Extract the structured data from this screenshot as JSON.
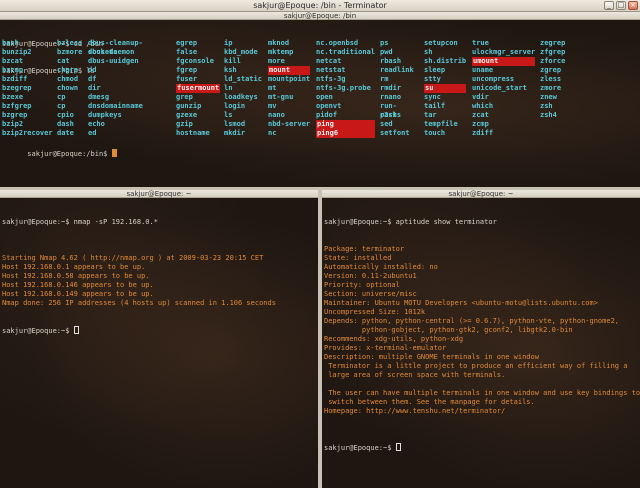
{
  "window": {
    "title": "sakjur@Epoque: /bin - Terminator"
  },
  "window_buttons": {
    "minimize": "_",
    "maximize": "□",
    "close": "×"
  },
  "top_pane": {
    "title": "sakjur@Epoque: /bin",
    "lines": [
      "sakjur@Epoque:~$ cd /bin",
      "sakjur@Epoque:/bin$ ls"
    ],
    "final_prompt": "sakjur@Epoque:/bin$ ",
    "ls_columns": [
      [
        {
          "n": "bash"
        },
        {
          "n": "bunzip2"
        },
        {
          "n": "bzcat"
        },
        {
          "n": "bzcmp"
        },
        {
          "n": "bzdiff"
        },
        {
          "n": "bzegrep"
        },
        {
          "n": "bzexe"
        },
        {
          "n": "bzfgrep"
        },
        {
          "n": "bzgrep"
        },
        {
          "n": "bzip2"
        },
        {
          "n": "bzip2recover"
        }
      ],
      [
        {
          "n": "bzless"
        },
        {
          "n": "bzmore"
        },
        {
          "n": "cat"
        },
        {
          "n": "chgrp"
        },
        {
          "n": "chmod"
        },
        {
          "n": "chown"
        },
        {
          "n": "cp"
        },
        {
          "n": "cp"
        },
        {
          "n": "cpio"
        },
        {
          "n": "dash"
        },
        {
          "n": "date"
        }
      ],
      [
        {
          "n": "dbus-cleanup-sockets"
        },
        {
          "n": "dbus-daemon"
        },
        {
          "n": "dbus-uuidgen"
        },
        {
          "n": "dd"
        },
        {
          "n": "df"
        },
        {
          "n": "dir"
        },
        {
          "n": "dmesg"
        },
        {
          "n": "dnsdomainname"
        },
        {
          "n": "dumpkeys"
        },
        {
          "n": "echo"
        },
        {
          "n": "ed"
        }
      ],
      [
        {
          "n": "egrep"
        },
        {
          "n": "false"
        },
        {
          "n": "fgconsole"
        },
        {
          "n": "fgrep"
        },
        {
          "n": "fuser"
        },
        {
          "n": "fusermount",
          "hl": true
        },
        {
          "n": "grep"
        },
        {
          "n": "gunzip"
        },
        {
          "n": "gzexe"
        },
        {
          "n": "gzip"
        },
        {
          "n": "hostname"
        }
      ],
      [
        {
          "n": "ip"
        },
        {
          "n": "kbd_mode"
        },
        {
          "n": "kill"
        },
        {
          "n": "ksh"
        },
        {
          "n": "ld_static"
        },
        {
          "n": "ln"
        },
        {
          "n": "loadkeys"
        },
        {
          "n": "login"
        },
        {
          "n": "ls"
        },
        {
          "n": "lsmod"
        },
        {
          "n": "mkdir"
        }
      ],
      [
        {
          "n": "mknod"
        },
        {
          "n": "mktemp"
        },
        {
          "n": "more"
        },
        {
          "n": "mount",
          "hl": true
        },
        {
          "n": "mountpoint"
        },
        {
          "n": "mt"
        },
        {
          "n": "mt-gnu"
        },
        {
          "n": "mv"
        },
        {
          "n": "nano"
        },
        {
          "n": "nbd-server"
        },
        {
          "n": "nc"
        }
      ],
      [
        {
          "n": "nc.openbsd"
        },
        {
          "n": "nc.traditional"
        },
        {
          "n": "netcat"
        },
        {
          "n": "netstat"
        },
        {
          "n": "ntfs-3g"
        },
        {
          "n": "ntfs-3g.probe"
        },
        {
          "n": "open"
        },
        {
          "n": "openvt"
        },
        {
          "n": "pidof"
        },
        {
          "n": "ping",
          "hl": true
        },
        {
          "n": "ping6",
          "hl": true
        }
      ],
      [
        {
          "n": "ps"
        },
        {
          "n": "pwd"
        },
        {
          "n": "rbash"
        },
        {
          "n": "readlink"
        },
        {
          "n": "rm"
        },
        {
          "n": "rmdir"
        },
        {
          "n": "rnano"
        },
        {
          "n": "run-parts"
        },
        {
          "n": "r2sh"
        },
        {
          "n": "sed"
        },
        {
          "n": "setfont"
        }
      ],
      [
        {
          "n": "setupcon"
        },
        {
          "n": "sh"
        },
        {
          "n": "sh.distrib"
        },
        {
          "n": "sleep"
        },
        {
          "n": "stty"
        },
        {
          "n": "su",
          "hl": true
        },
        {
          "n": "sync"
        },
        {
          "n": "tailf"
        },
        {
          "n": "tar"
        },
        {
          "n": "tempfile"
        },
        {
          "n": "touch"
        }
      ],
      [
        {
          "n": "true"
        },
        {
          "n": "ulockmgr_server"
        },
        {
          "n": "umount",
          "hl": true
        },
        {
          "n": "uname"
        },
        {
          "n": "uncompress"
        },
        {
          "n": "unicode_start"
        },
        {
          "n": "vdir"
        },
        {
          "n": "which"
        },
        {
          "n": "zcat"
        },
        {
          "n": "zcmp"
        },
        {
          "n": "zdiff"
        }
      ],
      [
        {
          "n": "zegrep"
        },
        {
          "n": "zfgrep"
        },
        {
          "n": "zforce"
        },
        {
          "n": "zgrep"
        },
        {
          "n": "zless"
        },
        {
          "n": "zmore"
        },
        {
          "n": "znew"
        },
        {
          "n": "zsh"
        },
        {
          "n": "zsh4"
        }
      ]
    ]
  },
  "bottom_left_pane": {
    "title": "sakjur@Epoque: ~",
    "command": "sakjur@Epoque:~$ nmap -sP 192.168.0.*",
    "output": [
      "",
      "Starting Nmap 4.62 ( http://nmap.org ) at 2009-03-23 20:15 CET",
      "Host 192.168.0.1 appears to be up.",
      "Host 192.168.0.58 appears to be up.",
      "Host 192.168.0.146 appears to be up.",
      "Host 192.168.0.149 appears to be up.",
      "Nmap done: 256 IP addresses (4 hosts up) scanned in 1.106 seconds"
    ],
    "final_prompt": "sakjur@Epoque:~$ "
  },
  "bottom_right_pane": {
    "title": "sakjur@Epoque: ~",
    "command": "sakjur@Epoque:~$ aptitude show terminator",
    "output": [
      "Package: terminator",
      "State: installed",
      "Automatically installed: no",
      "Version: 0.11-2ubuntu1",
      "Priority: optional",
      "Section: universe/misc",
      "Maintainer: Ubuntu MOTU Developers <ubuntu-motu@lists.ubuntu.com>",
      "Uncompressed Size: 1012k",
      "Depends: python, python-central (>= 0.6.7), python-vte, python-gnome2,",
      "         python-gobject, python-gtk2, gconf2, libgtk2.0-bin",
      "Recommends: xdg-utils, python-xdg",
      "Provides: x-terminal-emulator",
      "Description: multiple GNOME terminals in one window",
      " Terminator is a little project to produce an efficient way of filling a",
      " large area of screen space with terminals.",
      "",
      " The user can have multiple terminals in one window and use key bindings to",
      " switch between them. See the manpage for details.",
      "Homepage: http://www.tenshu.net/terminator/",
      ""
    ],
    "final_prompt": "sakjur@Epoque:~$ "
  }
}
